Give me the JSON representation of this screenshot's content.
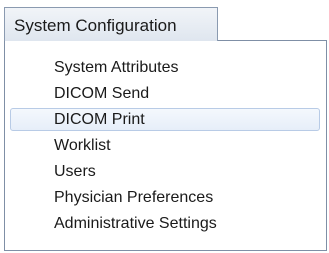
{
  "menu": {
    "title": "System Configuration",
    "items": [
      {
        "label": "System Attributes"
      },
      {
        "label": "DICOM Send"
      },
      {
        "label": "DICOM Print",
        "highlighted": true
      },
      {
        "label": "Worklist"
      },
      {
        "label": "Users"
      },
      {
        "label": "Physician Preferences"
      },
      {
        "label": "Administrative Settings"
      }
    ]
  },
  "colors": {
    "trigger_border": "#8a9ab0",
    "trigger_bg_top": "#f1f4f8",
    "trigger_bg_bottom": "#dfe6ef",
    "panel_border": "#7f8fa6",
    "highlight_border": "#b8cbe6",
    "highlight_bg": "#e6eef9"
  }
}
